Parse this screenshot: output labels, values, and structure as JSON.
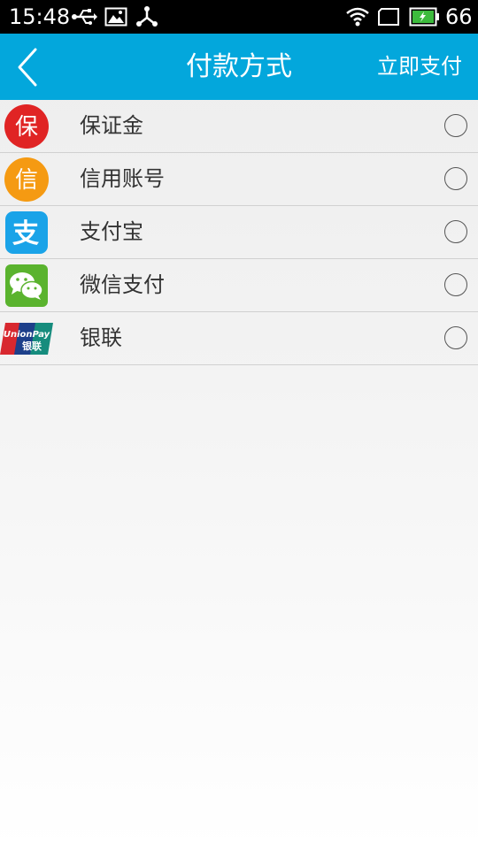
{
  "status_bar": {
    "time": "15:48",
    "battery_level": "66",
    "icons": [
      "usb-icon",
      "image-icon",
      "share-icon",
      "wifi-icon",
      "screen-rotate-icon",
      "battery-icon"
    ]
  },
  "header": {
    "title": "付款方式",
    "pay_now_label": "立即支付",
    "back_icon": "chevron-left-icon"
  },
  "payment_methods": [
    {
      "label": "保证金",
      "icon": "deposit-icon",
      "icon_text": "保",
      "icon_color": "#e02424",
      "selected": false
    },
    {
      "label": "信用账号",
      "icon": "credit-icon",
      "icon_text": "信",
      "icon_color": "#f59a12",
      "selected": false
    },
    {
      "label": "支付宝",
      "icon": "alipay-icon",
      "icon_text": "支",
      "icon_color": "#1aa3e8",
      "selected": false
    },
    {
      "label": "微信支付",
      "icon": "wechat-pay-icon",
      "icon_color": "#5ab32e",
      "selected": false
    },
    {
      "label": "银联",
      "icon": "unionpay-icon",
      "icon_text_latin": "UnionPay",
      "icon_text_cn": "银联",
      "selected": false
    }
  ],
  "colors": {
    "header_bg": "#03a7dc",
    "status_bar_bg": "#000000"
  }
}
